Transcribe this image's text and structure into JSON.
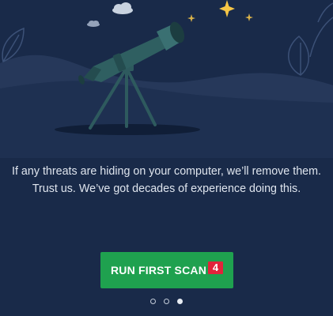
{
  "message": {
    "line1": "If any threats are hiding on your computer, we’ll remove them.",
    "line2": "Trust us. We’ve got decades of experience doing this."
  },
  "scan_button": {
    "label": "RUN FIRST SCAN",
    "badge": "4"
  },
  "pager": {
    "total_pages": 3,
    "current_page": 3
  },
  "illustration": {
    "subject": "telescope-on-tripod",
    "sparkle_icon": "sparkle-icon",
    "cloud_icon": "cloud-icon",
    "leaf_icon": "leaf-outline-icon"
  },
  "colors": {
    "background": "#192a49",
    "hills": "#26385a",
    "button_green": "#1fa14f",
    "badge_red": "#e2233b",
    "star_yellow": "#f6c646",
    "telescope": "#2f5f61"
  }
}
